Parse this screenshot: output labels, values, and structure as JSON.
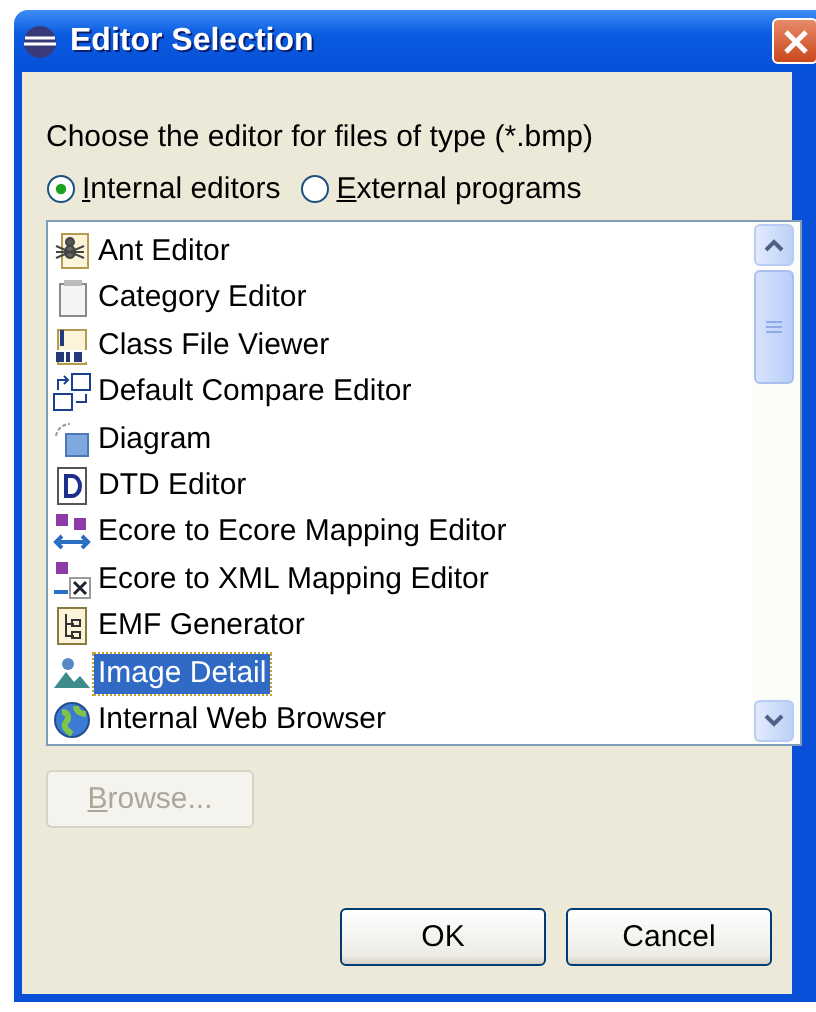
{
  "window": {
    "title": "Editor Selection"
  },
  "prompt": "Choose the editor for files of type (*.bmp)",
  "options": [
    {
      "label": "Internal editors",
      "selected": true
    },
    {
      "label": "External programs",
      "selected": false
    }
  ],
  "editors": [
    {
      "label": "Ant Editor",
      "selected": false
    },
    {
      "label": "Category Editor",
      "selected": false
    },
    {
      "label": "Class File Viewer",
      "selected": false
    },
    {
      "label": "Default Compare Editor",
      "selected": false
    },
    {
      "label": "Diagram",
      "selected": false
    },
    {
      "label": "DTD Editor",
      "selected": false
    },
    {
      "label": "Ecore to Ecore Mapping Editor",
      "selected": false
    },
    {
      "label": "Ecore to XML Mapping Editor",
      "selected": false
    },
    {
      "label": "EMF Generator",
      "selected": false
    },
    {
      "label": "Image Detail",
      "selected": true
    },
    {
      "label": "Internal Web Browser",
      "selected": false
    }
  ],
  "browse_button": {
    "label": "Browse...",
    "disabled": true
  },
  "buttons": [
    "OK",
    "Cancel"
  ]
}
